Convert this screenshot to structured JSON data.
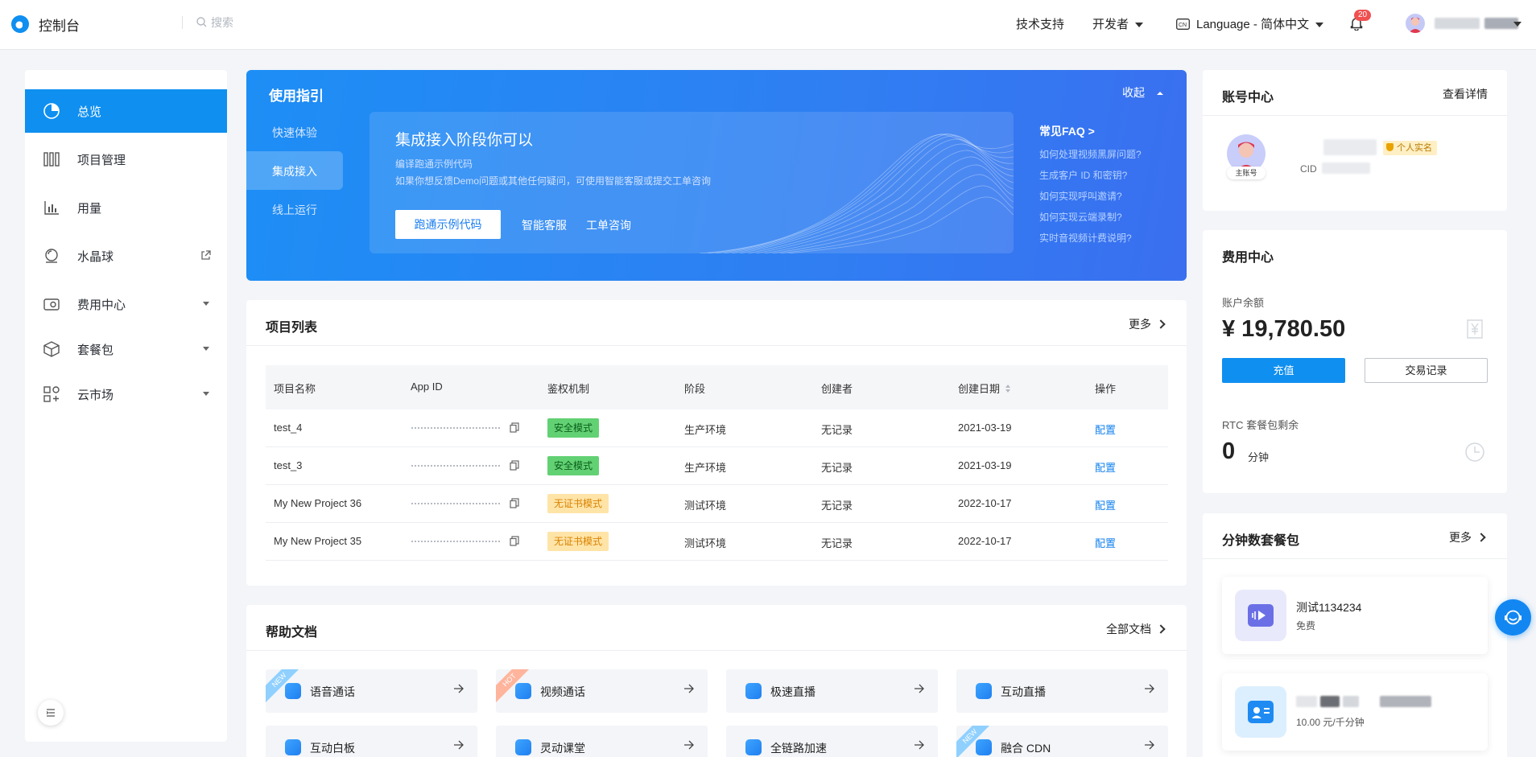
{
  "header": {
    "app_title": "控制台",
    "search_placeholder": "搜索",
    "tech_support": "技术支持",
    "developer": "开发者",
    "language": "Language - 简体中文",
    "notification_count": "20"
  },
  "sidebar": {
    "items": [
      {
        "label": "总览",
        "icon": "dashboard-icon"
      },
      {
        "label": "项目管理",
        "icon": "project-icon"
      },
      {
        "label": "用量",
        "icon": "usage-chart-icon"
      },
      {
        "label": "水晶球",
        "icon": "crystal-ball-icon"
      },
      {
        "label": "费用中心",
        "icon": "wallet-icon"
      },
      {
        "label": "套餐包",
        "icon": "package-icon"
      },
      {
        "label": "云市场",
        "icon": "marketplace-icon"
      }
    ]
  },
  "guide": {
    "title": "使用指引",
    "collapse": "收起",
    "tabs": [
      "快速体验",
      "集成接入",
      "线上运行"
    ],
    "panel_title": "集成接入阶段你可以",
    "desc1": "编译跑通示例代码",
    "desc2": "如果你想反馈Demo问题或其他任何疑问，可使用智能客服或提交工单咨询",
    "primary_button": "跑通示例代码",
    "link_service": "智能客服",
    "link_ticket": "工单咨询",
    "faq_title": "常见FAQ >",
    "faq": [
      "如何处理视频黑屏问题?",
      "生成客户 ID 和密钥?",
      "如何实现呼叫邀请?",
      "如何实现云端录制?",
      "实时音视频计费说明?"
    ]
  },
  "projects": {
    "title": "项目列表",
    "more": "更多",
    "columns": [
      "项目名称",
      "App ID",
      "鉴权机制",
      "阶段",
      "创建者",
      "创建日期",
      "操作"
    ],
    "rows": [
      {
        "name": "test_4",
        "auth": "安全模式",
        "stage": "生产环境",
        "creator": "无记录",
        "date": "2021-03-19",
        "action": "配置"
      },
      {
        "name": "test_3",
        "auth": "安全模式",
        "stage": "生产环境",
        "creator": "无记录",
        "date": "2021-03-19",
        "action": "配置"
      },
      {
        "name": "My New Project 36",
        "auth": "无证书模式",
        "stage": "测试环境",
        "creator": "无记录",
        "date": "2022-10-17",
        "action": "配置"
      },
      {
        "name": "My New Project 35",
        "auth": "无证书模式",
        "stage": "测试环境",
        "creator": "无记录",
        "date": "2022-10-17",
        "action": "配置"
      }
    ]
  },
  "docs": {
    "title": "帮助文档",
    "more": "全部文档",
    "items": [
      {
        "label": "语音通话",
        "tag": "NEW"
      },
      {
        "label": "视频通话",
        "tag": "HOT"
      },
      {
        "label": "极速直播",
        "tag": ""
      },
      {
        "label": "互动直播",
        "tag": ""
      },
      {
        "label": "互动白板",
        "tag": ""
      },
      {
        "label": "灵动课堂",
        "tag": ""
      },
      {
        "label": "全链路加速",
        "tag": ""
      },
      {
        "label": "融合 CDN",
        "tag": "NEW"
      }
    ]
  },
  "account": {
    "title": "账号中心",
    "details": "查看详情",
    "avatar_tag": "主账号",
    "realname": "个人实名",
    "cid_label": "CID"
  },
  "fees": {
    "title": "费用中心",
    "balance_label": "账户余额",
    "balance": "¥ 19,780.50",
    "recharge": "充值",
    "records": "交易记录",
    "rtc_label": "RTC 套餐包剩余",
    "rtc_value": "0",
    "rtc_unit": "分钟"
  },
  "packages": {
    "title": "分钟数套餐包",
    "more": "更多",
    "items": [
      {
        "name": "测试1134234",
        "sub": "免费"
      },
      {
        "name": "",
        "sub": "10.00 元/千分钟"
      }
    ]
  }
}
